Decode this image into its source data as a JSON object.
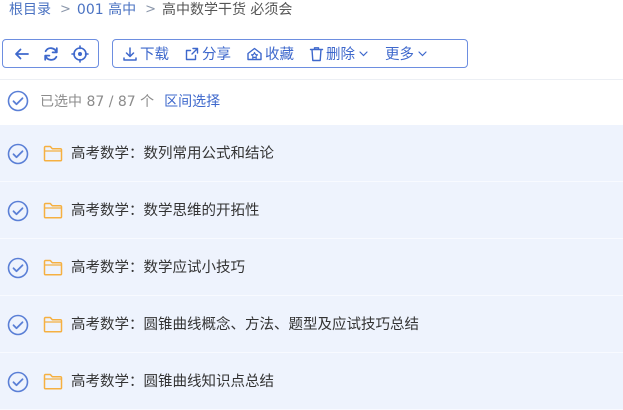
{
  "breadcrumb": {
    "items": [
      "根目录",
      "001 高中",
      "高中数学干货 必须会"
    ],
    "separator": ">"
  },
  "toolbar": {
    "nav": {
      "back_icon": "arrow-left-icon",
      "refresh_icon": "refresh-icon",
      "locate_icon": "locate-icon"
    },
    "actions": {
      "download": "下载",
      "share": "分享",
      "favorite": "收藏",
      "delete": "删除",
      "more": "更多"
    }
  },
  "selection": {
    "info": "已选中 87 / 87 个",
    "range_select": "区间选择"
  },
  "files": [
    {
      "name": "高考数学：数列常用公式和结论",
      "checked": true,
      "type": "folder"
    },
    {
      "name": "高考数学：数学思维的开拓性",
      "checked": true,
      "type": "folder"
    },
    {
      "name": "高考数学：数学应试小技巧",
      "checked": true,
      "type": "folder"
    },
    {
      "name": "高考数学：圆锥曲线概念、方法、题型及应试技巧总结",
      "checked": true,
      "type": "folder"
    },
    {
      "name": "高考数学：圆锥曲线知识点总结",
      "checked": true,
      "type": "folder"
    }
  ],
  "colors": {
    "accent": "#3e68cc",
    "row_bg": "#eef3fd",
    "folder": "#f5b041",
    "check": "#5a7fd6"
  }
}
